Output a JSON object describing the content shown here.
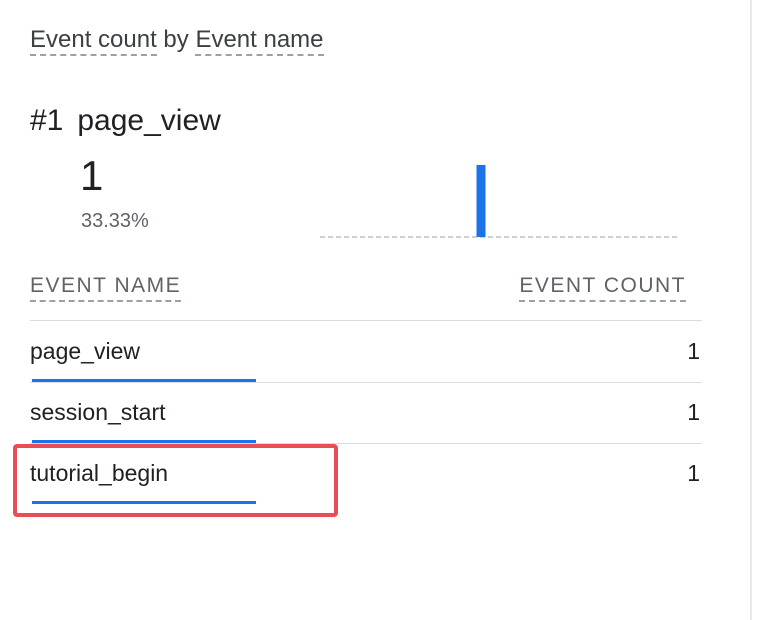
{
  "card": {
    "title_metric": "Event count",
    "title_by": " by ",
    "title_dimension": "Event name"
  },
  "top_item": {
    "rank": "#1",
    "name": "page_view",
    "value": "1",
    "percent": "33.33%"
  },
  "table": {
    "col_name_header": "EVENT NAME",
    "col_count_header": "EVENT COUNT",
    "rows": [
      {
        "name": "page_view",
        "count": "1",
        "share": 1.0
      },
      {
        "name": "session_start",
        "count": "1",
        "share": 1.0
      },
      {
        "name": "tutorial_begin",
        "count": "1",
        "share": 1.0
      }
    ]
  },
  "colors": {
    "accent": "#1a73e8",
    "highlight": "#ea4d56",
    "divider": "#dadce0"
  },
  "chart_data": {
    "type": "bar",
    "categories": [
      "page_view"
    ],
    "values": [
      1
    ],
    "title": "",
    "xlabel": "",
    "ylabel": "",
    "ylim": [
      0,
      1
    ]
  }
}
